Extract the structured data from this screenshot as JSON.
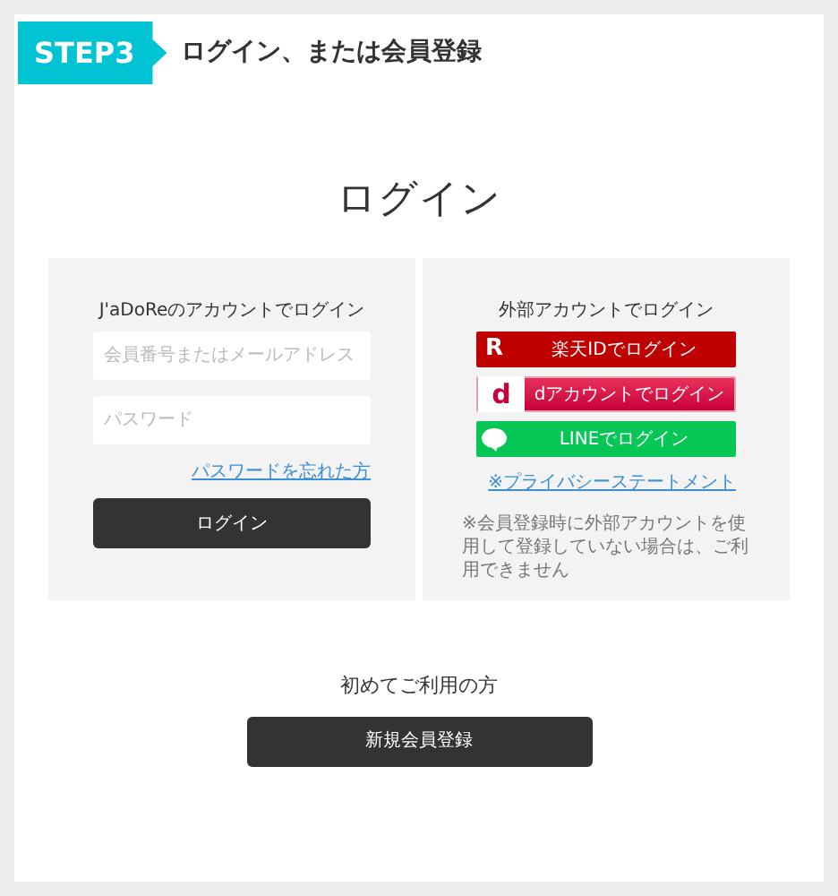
{
  "step": {
    "badge": "STEP3",
    "title": "ログイン、または会員登録"
  },
  "heading": "ログイン",
  "member_login": {
    "title": "J'aDoReのアカウントでログイン",
    "fields": [
      {
        "placeholder": "会員番号またはメールアドレス"
      },
      {
        "placeholder": "パスワード"
      }
    ],
    "forgot_link": "パスワードを忘れた方",
    "button": "ログイン"
  },
  "external_login": {
    "title": "外部アカウントでログイン",
    "buttons": [
      {
        "kind": "rakuten",
        "logo": "R",
        "label": "楽天IDでログイン"
      },
      {
        "kind": "docomo",
        "logo": "d",
        "label": "dアカウントでログイン"
      },
      {
        "kind": "line",
        "label": "LINEでログイン"
      }
    ],
    "privacy_link": "※プライバシーステートメント",
    "note": "※会員登録時に外部アカウントを使用して登録していない場合は、ご利用できません"
  },
  "register": {
    "title": "初めてご利用の方",
    "button": "新規会員登録"
  }
}
